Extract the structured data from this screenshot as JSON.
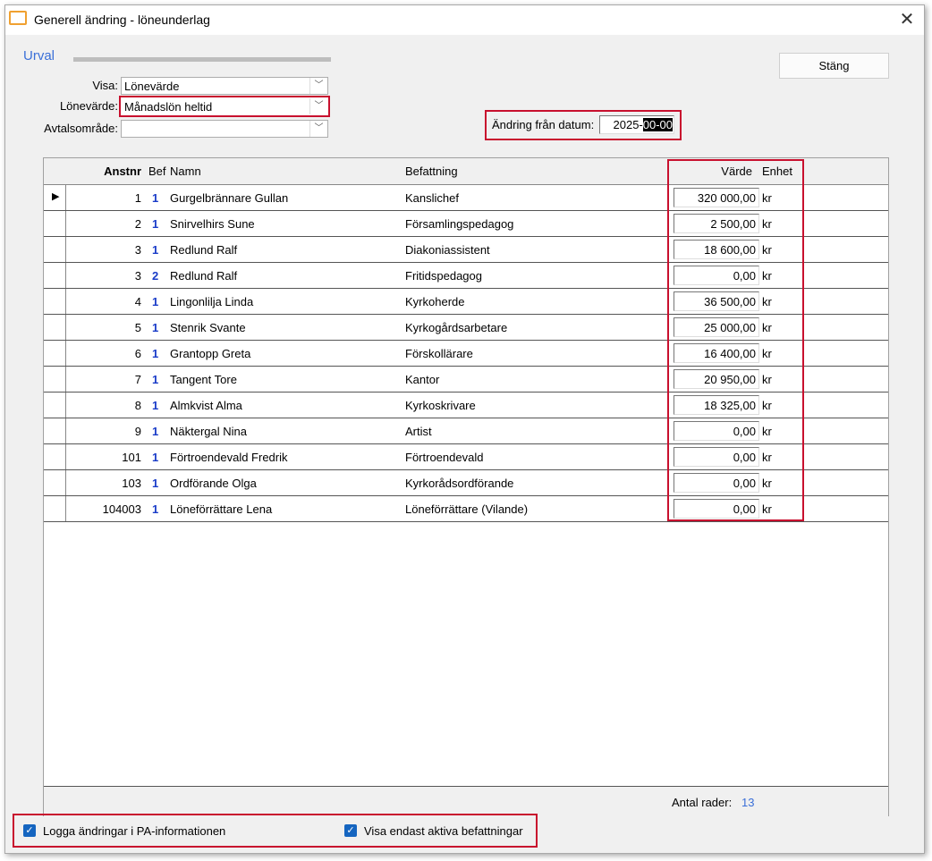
{
  "window": {
    "title": "Generell ändring - löneunderlag",
    "close": "✕"
  },
  "urval": {
    "title": "Urval",
    "visa_label": "Visa:",
    "visa_value": "Lönevärde",
    "lonevarde_label": "Lönevärde:",
    "lonevarde_value": "Månadslön heltid",
    "avtal_label": "Avtalsområde:",
    "avtal_value": ""
  },
  "date": {
    "label": "Ändring från datum:",
    "value_plain": "2025-",
    "value_selected": "00-00"
  },
  "close_button": "Stäng",
  "table": {
    "headers": {
      "anstnr": "Anstnr",
      "bef": "Bef",
      "namn": "Namn",
      "befattning": "Befattning",
      "varde": "Värde",
      "enhet": "Enhet"
    },
    "rows": [
      {
        "anstnr": "1",
        "bef": "1",
        "namn": "Gurgelbrännare Gullan",
        "befattning": "Kanslichef",
        "varde": "320 000,00",
        "enhet": "kr"
      },
      {
        "anstnr": "2",
        "bef": "1",
        "namn": "Snirvelhirs Sune",
        "befattning": "Församlingspedagog",
        "varde": "2 500,00",
        "enhet": "kr"
      },
      {
        "anstnr": "3",
        "bef": "1",
        "namn": "Redlund Ralf",
        "befattning": "Diakoniassistent",
        "varde": "18 600,00",
        "enhet": "kr"
      },
      {
        "anstnr": "3",
        "bef": "2",
        "namn": "Redlund Ralf",
        "befattning": "Fritidspedagog",
        "varde": "0,00",
        "enhet": "kr"
      },
      {
        "anstnr": "4",
        "bef": "1",
        "namn": "Lingonlilja Linda",
        "befattning": "Kyrkoherde",
        "varde": "36 500,00",
        "enhet": "kr"
      },
      {
        "anstnr": "5",
        "bef": "1",
        "namn": "Stenrik Svante",
        "befattning": "Kyrkogårdsarbetare",
        "varde": "25 000,00",
        "enhet": "kr"
      },
      {
        "anstnr": "6",
        "bef": "1",
        "namn": "Grantopp Greta",
        "befattning": "Förskollärare",
        "varde": "16 400,00",
        "enhet": "kr"
      },
      {
        "anstnr": "7",
        "bef": "1",
        "namn": "Tangent Tore",
        "befattning": "Kantor",
        "varde": "20 950,00",
        "enhet": "kr"
      },
      {
        "anstnr": "8",
        "bef": "1",
        "namn": "Almkvist Alma",
        "befattning": "Kyrkoskrivare",
        "varde": "18 325,00",
        "enhet": "kr"
      },
      {
        "anstnr": "9",
        "bef": "1",
        "namn": "Näktergal Nina",
        "befattning": "Artist",
        "varde": "0,00",
        "enhet": "kr"
      },
      {
        "anstnr": "101",
        "bef": "1",
        "namn": "Förtroendevald Fredrik",
        "befattning": "Förtroendevald",
        "varde": "0,00",
        "enhet": "kr"
      },
      {
        "anstnr": "103",
        "bef": "1",
        "namn": "Ordförande Olga",
        "befattning": "Kyrkorådsordförande",
        "varde": "0,00",
        "enhet": "kr"
      },
      {
        "anstnr": "104003",
        "bef": "1",
        "namn": "Löneförrättare Lena",
        "befattning": "Löneförrättare (Vilande)",
        "varde": "0,00",
        "enhet": "kr"
      }
    ],
    "footer_label": "Antal rader:",
    "footer_count": "13"
  },
  "checkboxes": [
    {
      "label": "Logga ändringar i PA-informationen",
      "checked": true
    },
    {
      "label": "Visa endast aktiva befattningar",
      "checked": true
    }
  ]
}
